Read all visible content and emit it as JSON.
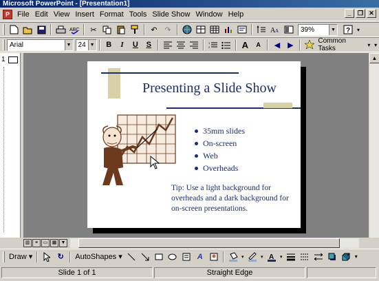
{
  "window": {
    "title": "Microsoft PowerPoint - [Presentation1]"
  },
  "menu": {
    "items": [
      "File",
      "Edit",
      "View",
      "Insert",
      "Format",
      "Tools",
      "Slide Show",
      "Window",
      "Help"
    ]
  },
  "toolbar_standard": {
    "zoom": "39%"
  },
  "toolbar_formatting": {
    "font": "Arial",
    "size": "24",
    "common_tasks": "Common Tasks"
  },
  "outline": {
    "slide_number": "1"
  },
  "slide": {
    "title": "Presenting a Slide Show",
    "bullets": [
      "35mm slides",
      "On-screen",
      "Web",
      "Overheads"
    ],
    "tip": "Tip:  Use a light background for overheads and a dark background for on-screen presentations."
  },
  "drawing_toolbar": {
    "draw_label": "Draw",
    "autoshapes_label": "AutoShapes"
  },
  "status": {
    "slide_info": "Slide 1 of 1",
    "design": "Straight Edge"
  },
  "colors": {
    "title_text": "#1a2e6b",
    "accent_block": "#d8d1a8",
    "workspace_bg": "#808080"
  }
}
